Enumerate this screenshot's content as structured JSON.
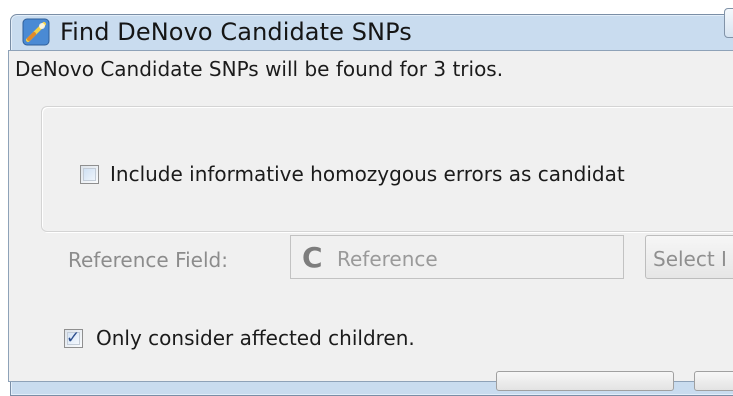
{
  "window": {
    "title": "Find DeNovo Candidate SNPs"
  },
  "dialog": {
    "info_text": "DeNovo Candidate SNPs will be found for 3 trios.",
    "include_homozygous": {
      "label": "Include informative homozygous errors as candidat",
      "checked": false
    },
    "reference": {
      "label": "Reference Field:",
      "field_icon_glyph": "C",
      "field_value": "Reference",
      "select_button_label": "Select I"
    },
    "affected_children": {
      "label": "Only consider affected children.",
      "checked": true,
      "check_glyph": "✓"
    }
  },
  "colors": {
    "title_bar": "#c9dcef",
    "dialog_bg": "#f0f0f0",
    "disabled_text": "#8c8c8c",
    "checkmark": "#2d4f8e"
  }
}
